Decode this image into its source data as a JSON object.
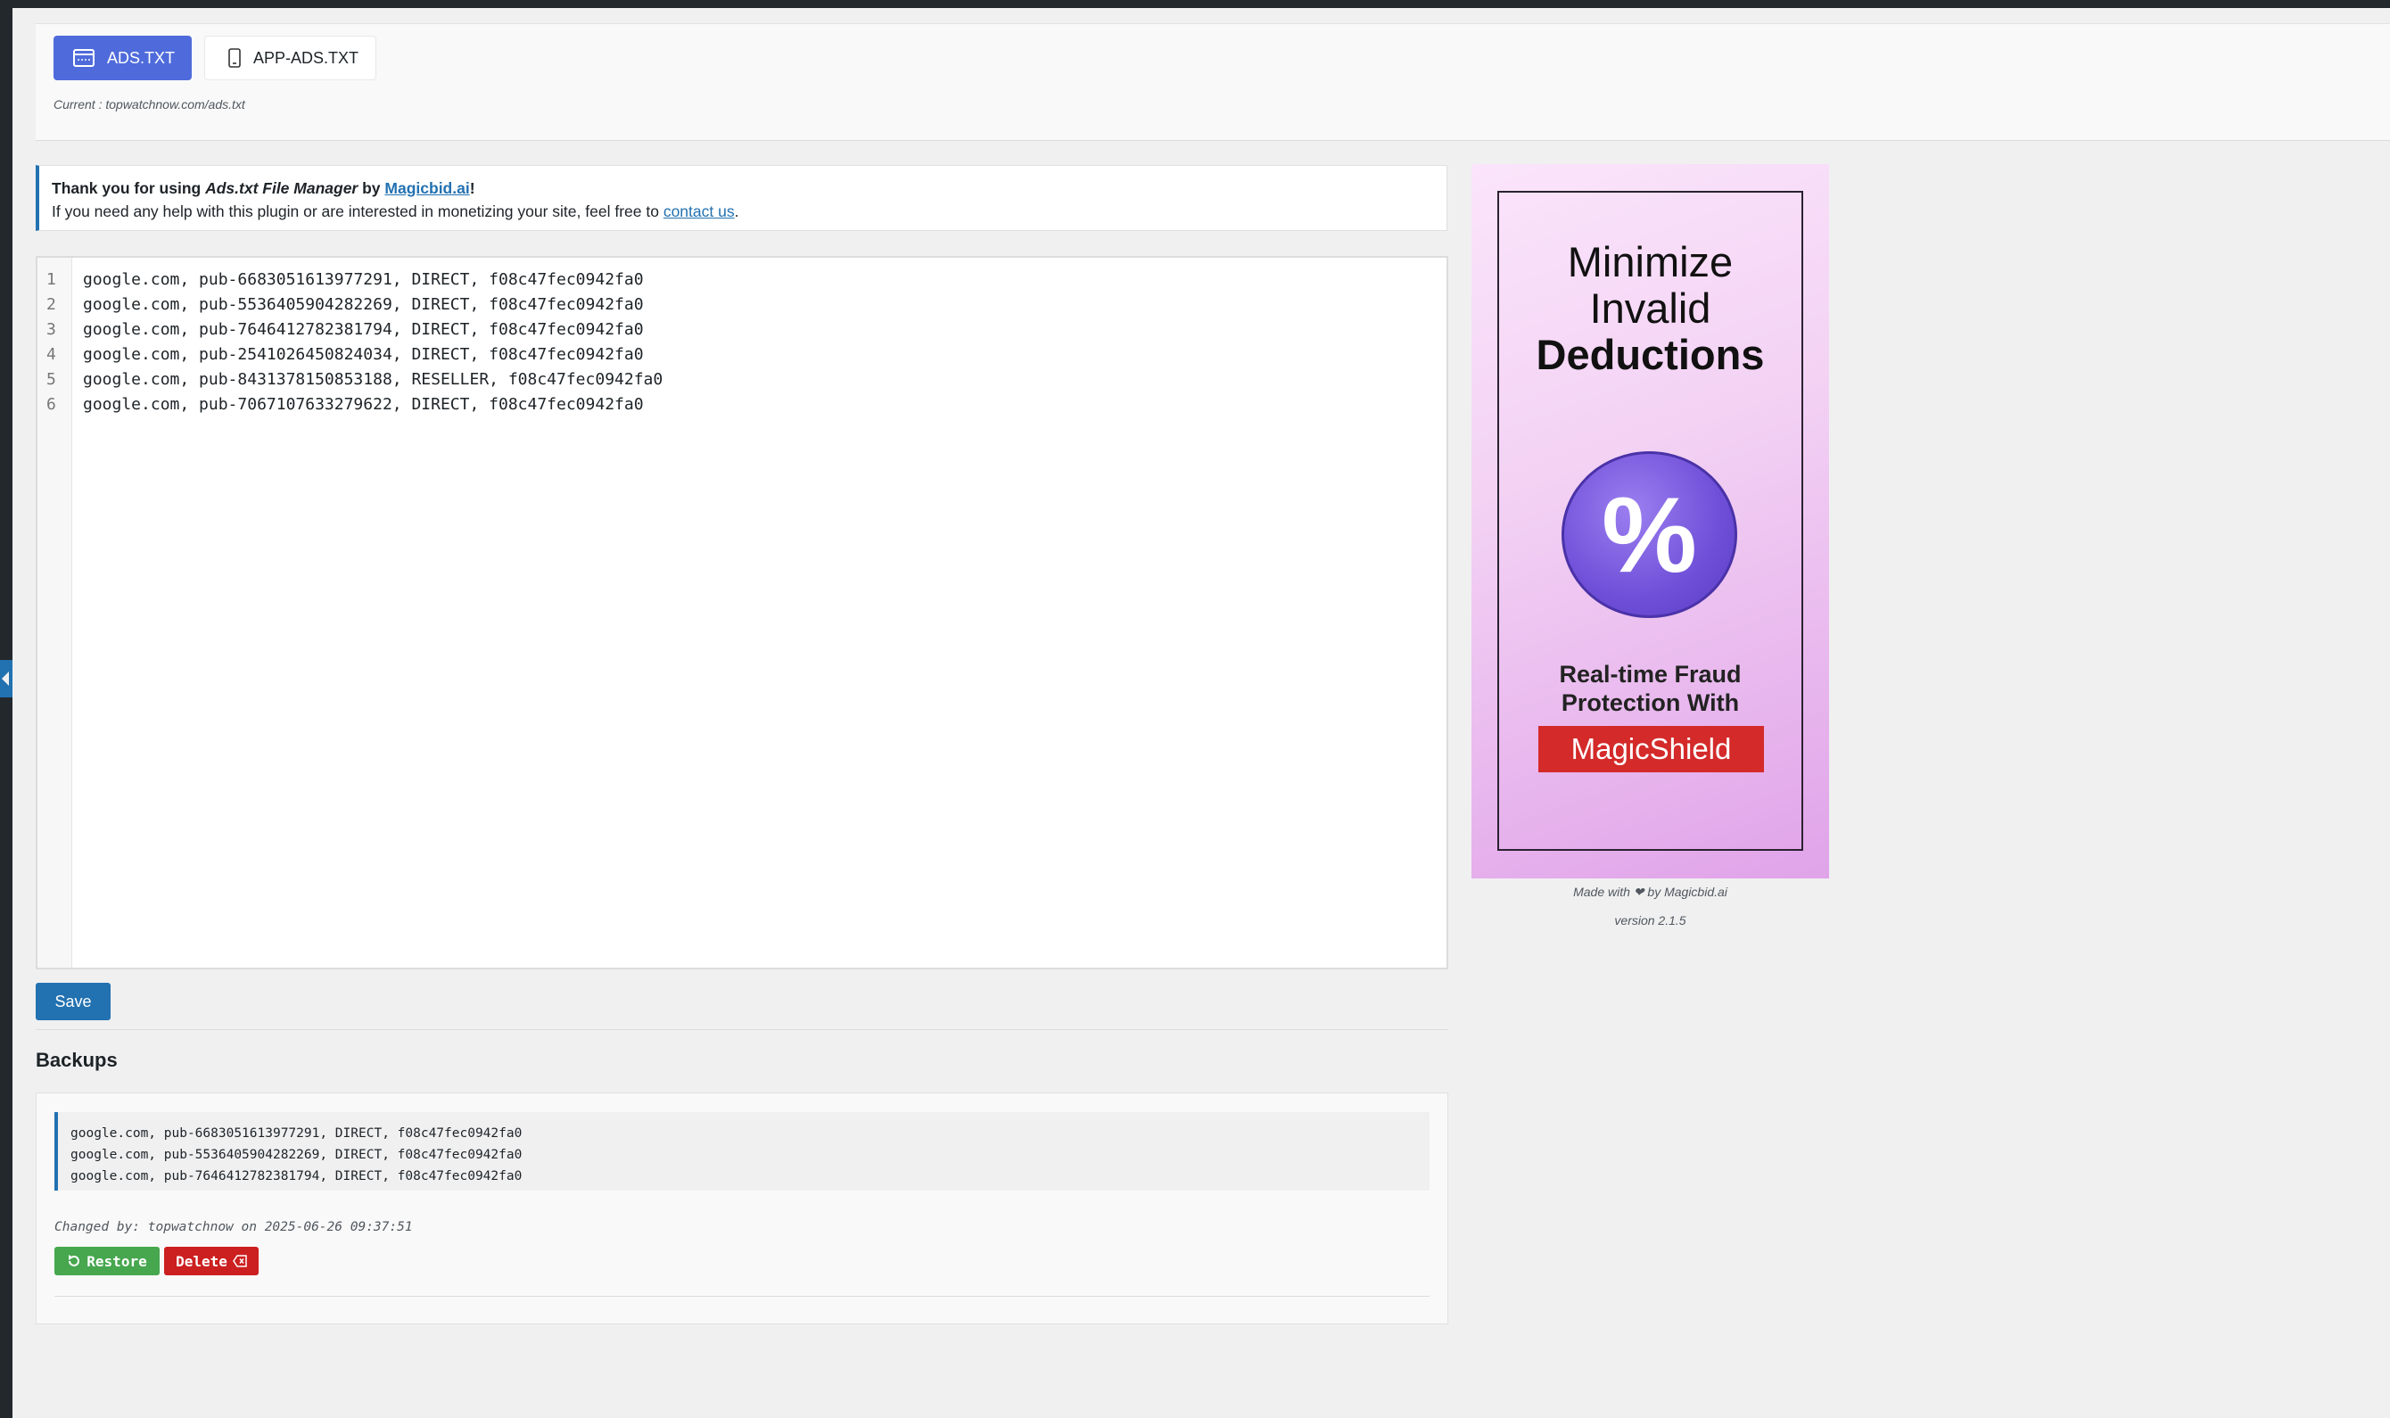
{
  "tabs": [
    {
      "label": "ADS.TXT",
      "active": true,
      "icon": "browser-window-icon"
    },
    {
      "label": "APP-ADS.TXT",
      "active": false,
      "icon": "mobile-phone-icon"
    }
  ],
  "current": {
    "prefix": "Current : ",
    "path": "topwatchnow.com/ads.txt"
  },
  "notice": {
    "thanks": "Thank you for using ",
    "plugin_name": "Ads.txt File Manager",
    "by": " by ",
    "brand_link": "Magicbid.ai",
    "exclaim": "!",
    "help_text": "If you need any help with this plugin or are interested in monetizing your site, feel free to ",
    "contact_link": "contact us",
    "period": "."
  },
  "editor": {
    "lines": [
      {
        "num": "1",
        "text": "google.com, pub-6683051613977291, DIRECT, f08c47fec0942fa0"
      },
      {
        "num": "2",
        "text": "google.com, pub-5536405904282269, DIRECT, f08c47fec0942fa0"
      },
      {
        "num": "3",
        "text": "google.com, pub-7646412782381794, DIRECT, f08c47fec0942fa0"
      },
      {
        "num": "4",
        "text": "google.com, pub-2541026450824034, DIRECT, f08c47fec0942fa0"
      },
      {
        "num": "5",
        "text": "google.com, pub-8431378150853188, RESELLER, f08c47fec0942fa0"
      },
      {
        "num": "6",
        "text": "google.com, pub-7067107633279622, DIRECT, f08c47fec0942fa0"
      }
    ]
  },
  "save_label": "Save",
  "backups": {
    "title": "Backups",
    "lines": [
      "google.com, pub-6683051613977291, DIRECT, f08c47fec0942fa0",
      "google.com, pub-5536405904282269, DIRECT, f08c47fec0942fa0",
      "google.com, pub-7646412782381794, DIRECT, f08c47fec0942fa0"
    ],
    "changed_by": "Changed by: topwatchnow on 2025-06-26 09:37:51",
    "restore_label": "Restore",
    "delete_label": "Delete"
  },
  "ad": {
    "line1": "Minimize",
    "line2": "Invalid",
    "line3": "Deductions",
    "symbol": "%",
    "sub1": "Real-time Fraud",
    "sub2": "Protection With",
    "brand": "MagicShield"
  },
  "footer": {
    "made_with_prefix": "Made with ",
    "heart": "❤",
    "made_with_suffix": " by Magicbid.ai",
    "version": "version 2.1.5"
  },
  "colors": {
    "primary": "#2271b1",
    "tab_active": "#4f6bdb",
    "restore": "#46a74e",
    "delete": "#cc1f1f",
    "brand_red": "#d42a2a"
  }
}
